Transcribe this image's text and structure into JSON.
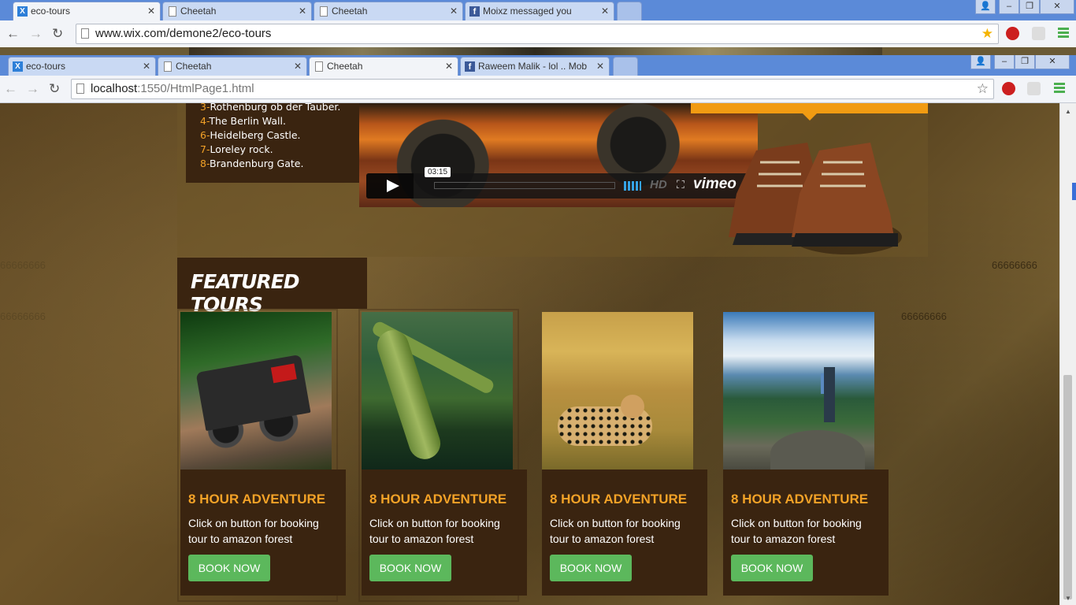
{
  "back_window": {
    "tabs": [
      {
        "title": "eco-tours",
        "icon": "wix-icon",
        "active": true
      },
      {
        "title": "Cheetah",
        "icon": "page-icon",
        "active": false
      },
      {
        "title": "Cheetah",
        "icon": "page-icon",
        "active": false
      },
      {
        "title": "Moixz messaged you",
        "icon": "facebook-icon",
        "active": false
      }
    ],
    "url": "www.wix.com/demone2/eco-tours"
  },
  "front_window": {
    "tabs": [
      {
        "title": "eco-tours",
        "icon": "wix-icon",
        "active": false
      },
      {
        "title": "Cheetah",
        "icon": "page-icon",
        "active": false
      },
      {
        "title": "Cheetah",
        "icon": "page-icon",
        "active": true
      },
      {
        "title": "Raweem Malik - lol .. Mob",
        "icon": "facebook-icon",
        "active": false
      }
    ],
    "url_host": "localhost",
    "url_rest": ":1550/HtmlPage1.html"
  },
  "page": {
    "list": [
      {
        "num": "3-",
        "text": "Rothenburg ob der Tauber."
      },
      {
        "num": "4-",
        "text": "The Berlin Wall."
      },
      {
        "num": "6-",
        "text": "Heidelberg Castle."
      },
      {
        "num": "7-",
        "text": "Loreley rock."
      },
      {
        "num": "8-",
        "text": "Brandenburg Gate."
      }
    ],
    "video": {
      "time": "03:15",
      "hd": "HD",
      "logo": "vimeo",
      "progress_percent": 0
    },
    "side_text": "66666666",
    "featured_title": "FEATURED TOURS",
    "tours": [
      {
        "title": "8 HOUR ADVENTURE",
        "desc": "Click on button for booking tour to amazon forest",
        "button": "BOOK NOW",
        "image": "offroad-jeep"
      },
      {
        "title": "8 HOUR ADVENTURE",
        "desc": "Click on button for booking tour to amazon forest",
        "button": "BOOK NOW",
        "image": "gharial-crocodile"
      },
      {
        "title": "8 HOUR ADVENTURE",
        "desc": "Click on button for booking tour to amazon forest",
        "button": "BOOK NOW",
        "image": "cheetah"
      },
      {
        "title": "8 HOUR ADVENTURE",
        "desc": "Click on button for booking tour to amazon forest",
        "button": "BOOK NOW",
        "image": "hiker-on-summit"
      }
    ]
  },
  "colors": {
    "accent_orange": "#f3a227",
    "dark_brown": "#3a2410",
    "button_green": "#5cb85c",
    "tab_bar_blue": "#5b8ad8"
  }
}
